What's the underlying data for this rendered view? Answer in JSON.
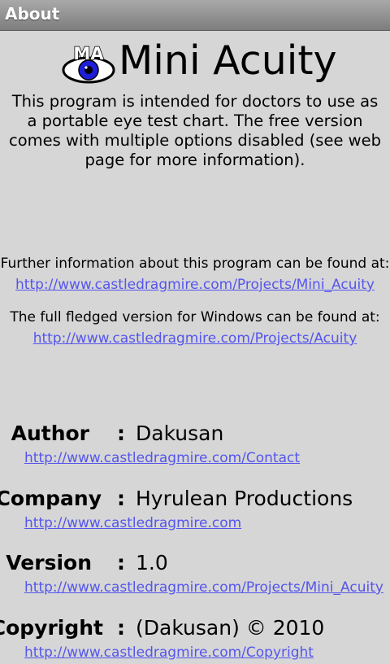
{
  "window": {
    "title": "About"
  },
  "app": {
    "name": "Mini Acuity",
    "logo_letters": "MA",
    "description": "This program is intended for doctors to use as a portable eye test chart. The free version comes with multiple options disabled (see web page for more information)."
  },
  "info": [
    {
      "label": "Further information about this program can be found at:",
      "link": "http://www.castledragmire.com/Projects/Mini_Acuity"
    },
    {
      "label": "The full fledged version for Windows can be found at:",
      "link": "http://www.castledragmire.com/Projects/Acuity"
    }
  ],
  "fields": [
    {
      "label": "Author",
      "value": "Dakusan",
      "link": "http://www.castledragmire.com/Contact"
    },
    {
      "label": "Company",
      "value": "Hyrulean Productions",
      "link": "http://www.castledragmire.com"
    },
    {
      "label": "Version",
      "value": "1.0",
      "link": "http://www.castledragmire.com/Projects/Mini_Acuity"
    },
    {
      "label": "Copyright",
      "value": "(Dakusan) © 2010",
      "link": "http://www.castledragmire.com/Copyright"
    }
  ],
  "separator": ":",
  "colors": {
    "background": "#d6d6d6",
    "link": "#5555ee",
    "eye_iris": "#1e1ed8"
  }
}
